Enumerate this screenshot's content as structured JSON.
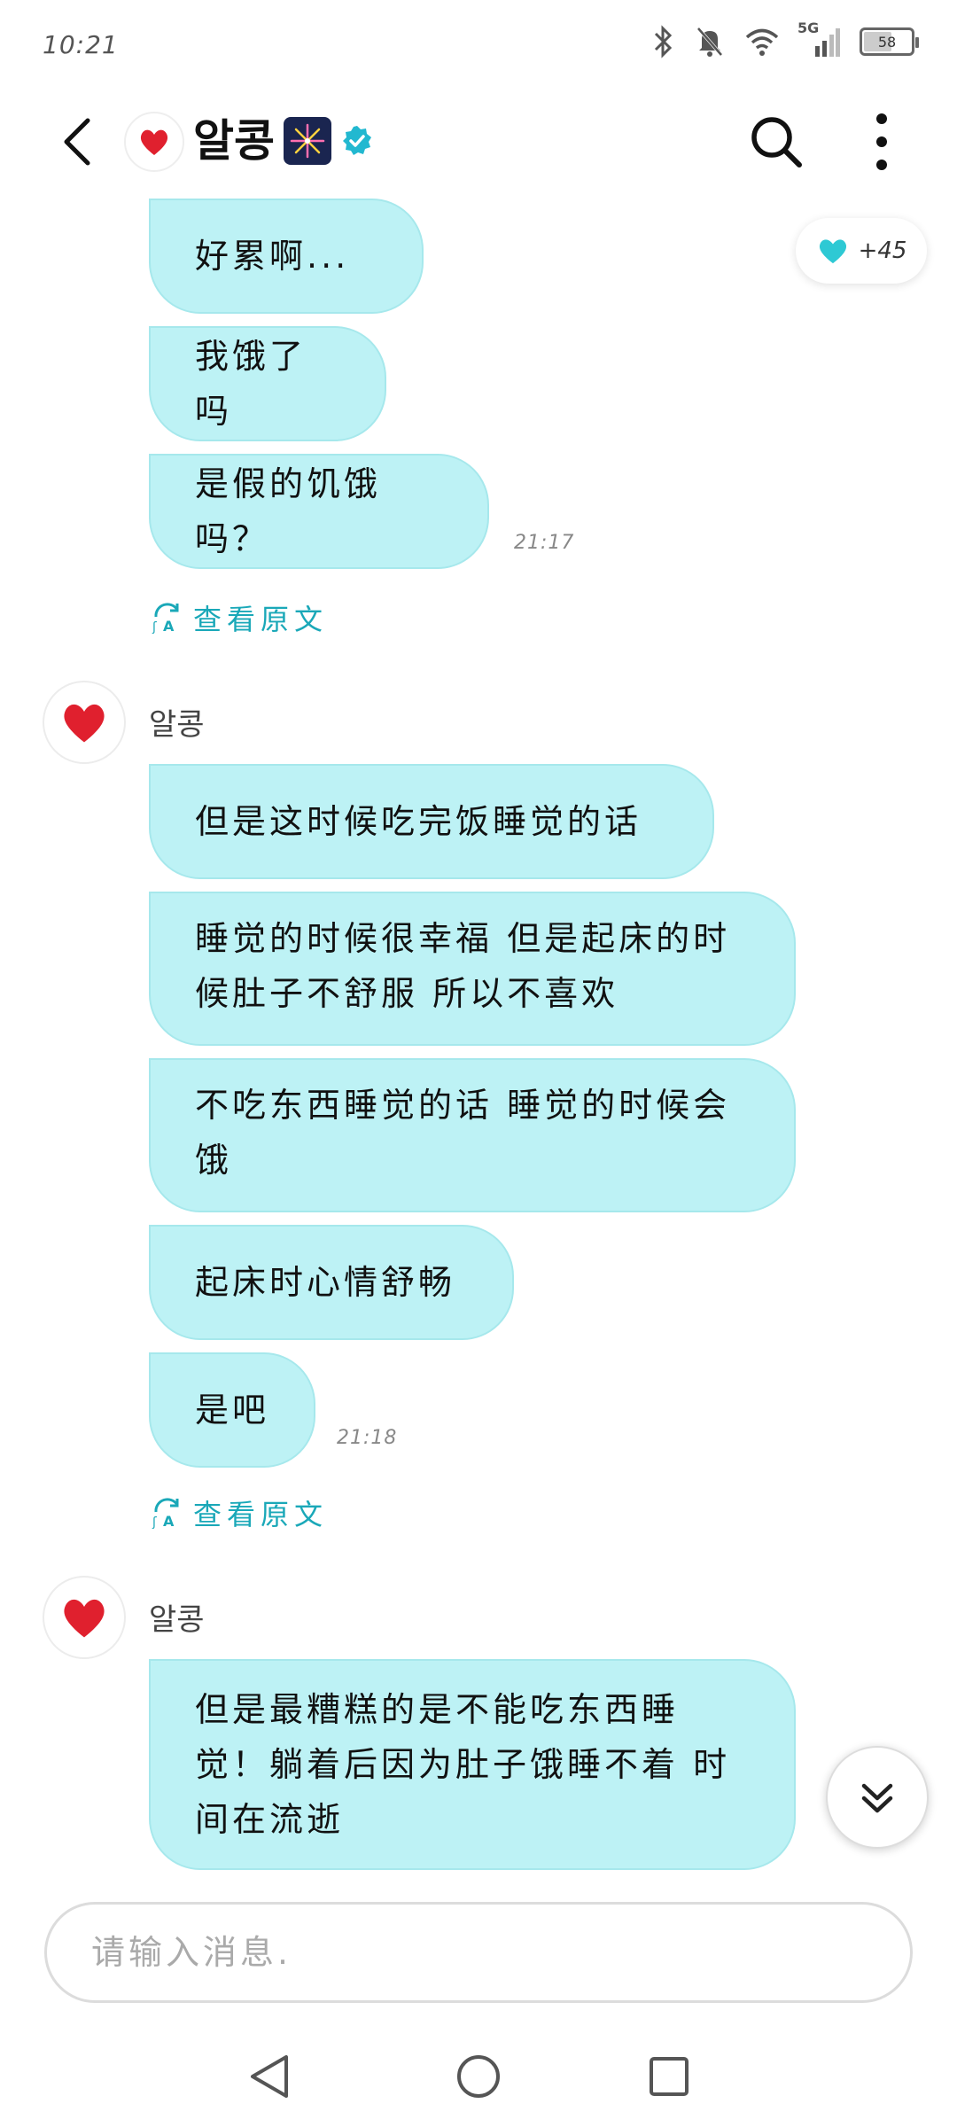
{
  "status_bar": {
    "time": "10:21",
    "network": "5G",
    "battery": "58"
  },
  "header": {
    "contact_name": "알콩",
    "fireworks_emoji": "🎆"
  },
  "heart_counter": {
    "count": "+45"
  },
  "translate_label": "查看原文",
  "messages_group1": [
    {
      "text": "好累啊..."
    },
    {
      "text": "我饿了吗"
    },
    {
      "text": "是假的饥饿吗？",
      "time": "21:17"
    }
  ],
  "sender2": {
    "name": "알콩"
  },
  "messages_group2": [
    {
      "text": "但是这时候吃完饭睡觉的话"
    },
    {
      "text": "睡觉的时候很幸福 但是起床的时候肚子不舒服 所以不喜欢"
    },
    {
      "text": "不吃东西睡觉的话 睡觉的时候会饿"
    },
    {
      "text": "起床时心情舒畅"
    },
    {
      "text": "是吧",
      "time": "21:18"
    }
  ],
  "sender3": {
    "name": "알콩"
  },
  "messages_group3": [
    {
      "text": "但是最糟糕的是不能吃东西睡觉！躺着后因为肚子饿睡不着 时间在流逝"
    }
  ],
  "input": {
    "placeholder": "请输入消息."
  },
  "colors": {
    "bubble": "#bdf2f5",
    "accent": "#1aa8b8",
    "heart": "#2ec9d4"
  }
}
